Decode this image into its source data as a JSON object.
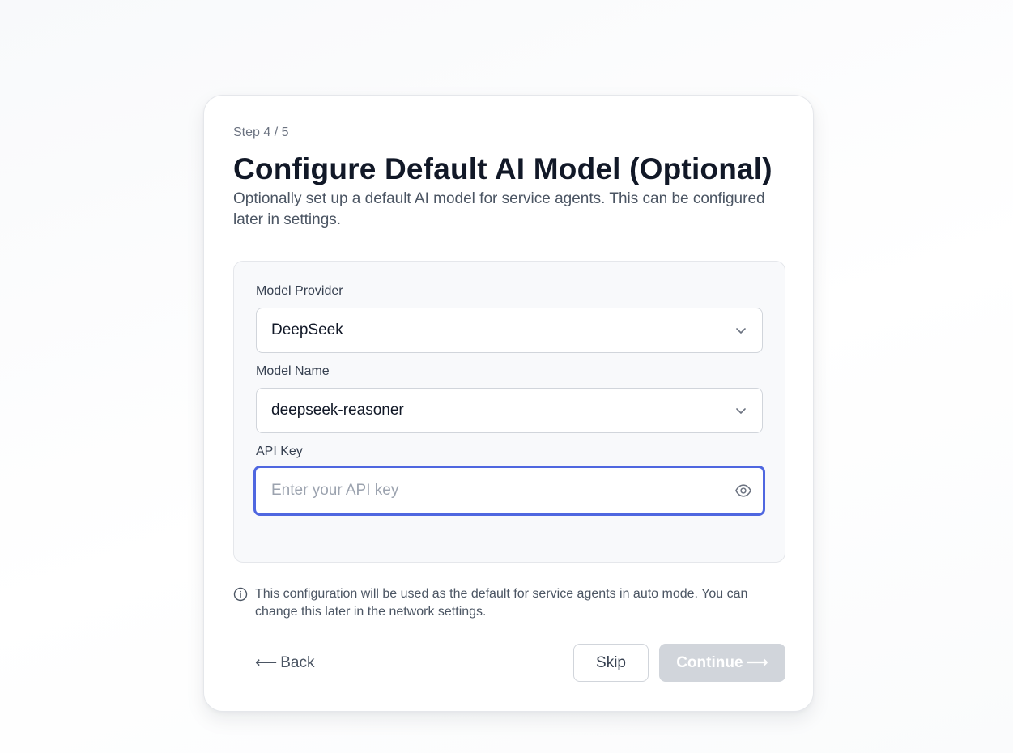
{
  "step": "Step 4 / 5",
  "title": "Configure Default AI Model (Optional)",
  "subtitle": "Optionally set up a default AI model for service agents. This can be configured later in settings.",
  "form": {
    "provider": {
      "label": "Model Provider",
      "value": "DeepSeek",
      "icon": "chevron-down-icon"
    },
    "model": {
      "label": "Model Name",
      "value": "deepseek-reasoner",
      "icon": "chevron-down-icon"
    },
    "api_key": {
      "label": "API Key",
      "placeholder": "Enter your API key",
      "value": "",
      "icon": "eye-icon"
    }
  },
  "note": {
    "icon": "info-icon",
    "text": "This configuration will be used as the default for service agents in auto mode. You can change this later in the network settings."
  },
  "actions": {
    "back_label": "Back",
    "back_icon": "arrow-left-icon",
    "skip_label": "Skip",
    "continue_label": "Continue",
    "continue_icon": "arrow-right-icon"
  },
  "colors": {
    "accent_focus": "#4f67e0",
    "continue_disabled": "#d1d5db"
  }
}
